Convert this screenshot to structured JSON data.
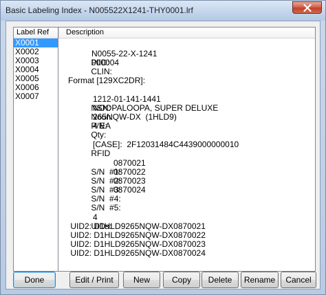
{
  "window": {
    "title": "Basic Labeling Index - N005522X1241-THY0001.lrf"
  },
  "list": {
    "header": "Label Ref",
    "items": [
      "X0001",
      "X0002",
      "X0003",
      "X0004",
      "X0005",
      "X0006",
      "X0007"
    ],
    "selected": "X0001"
  },
  "description": {
    "header": "Description",
    "piid_label": "PIID:",
    "piid_value": "N0055-22-X-1241",
    "clin_label": "CLIN:",
    "clin_value": "000004",
    "format": "Format [129XC2DR]:",
    "nsn_label": "NSN:",
    "nsn_value": "1212-01-141-1441",
    "noun_label": "Noun:",
    "noun_value": "NOOPALOOPA, SUPER DELUXE",
    "pn_label": "P/N:",
    "pn_value": "265NQW-DX  (1HLD9)",
    "qty_label": "Qty:",
    "qty_value": "4 EA",
    "rfid_label": "RFID",
    "rfid_value": "[CASE]:  2F12031484C4439000000010",
    "serials": [
      {
        "label": "S/N  #1:",
        "value": "0870021"
      },
      {
        "label": "S/N  #2:",
        "value": "0870022"
      },
      {
        "label": "S/N  #3:",
        "value": "0870023"
      },
      {
        "label": "S/N  #4:",
        "value": "0870024"
      },
      {
        "label": "S/N  #5:",
        "value": ""
      }
    ],
    "uids_label": "UIDs:",
    "uids_count": "4",
    "uid_lines": [
      " UID2: D1HLD9265NQW-DX0870021",
      " UID2: D1HLD9265NQW-DX0870022",
      " UID2: D1HLD9265NQW-DX0870023",
      " UID2: D1HLD9265NQW-DX0870024"
    ]
  },
  "buttons": {
    "done": "Done",
    "edit_print": "Edit / Print",
    "new": "New",
    "copy": "Copy",
    "delete": "Delete",
    "rename": "Rename",
    "cancel": "Cancel"
  },
  "colors": {
    "selection": "#3399ff",
    "close_button": "#c7432d"
  }
}
